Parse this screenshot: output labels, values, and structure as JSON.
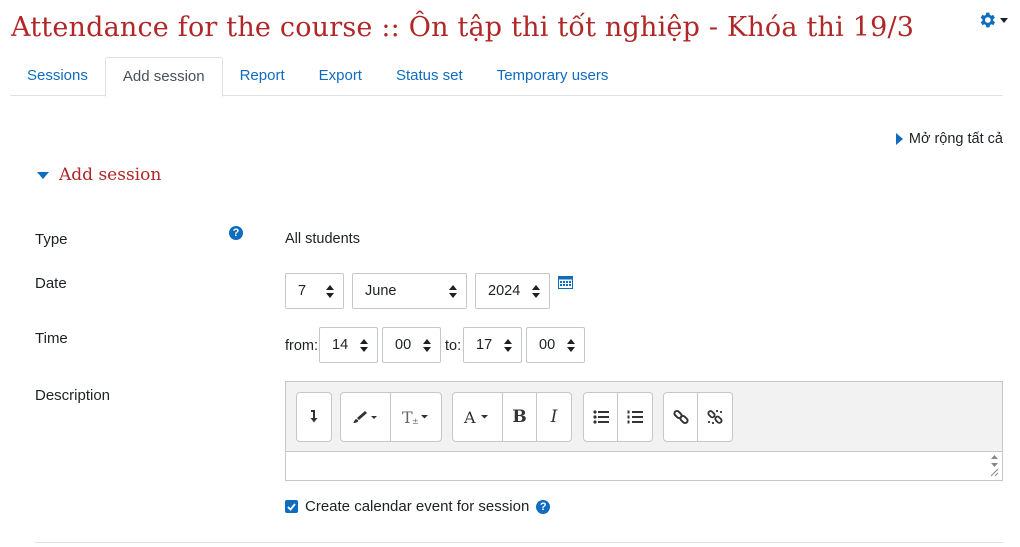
{
  "page": {
    "title": "Attendance for the course :: Ôn tập thi tốt nghiệp - Khóa thi 19/3"
  },
  "tabs": [
    "Sessions",
    "Add session",
    "Report",
    "Export",
    "Status set",
    "Temporary users"
  ],
  "active_tab": "Add session",
  "expand_all": "Mở rộng tất cả",
  "section": {
    "title": "Add session"
  },
  "form": {
    "type": {
      "label": "Type",
      "value": "All students"
    },
    "date": {
      "label": "Date",
      "day": "7",
      "month": "June",
      "year": "2024"
    },
    "time": {
      "label": "Time",
      "from_label": "from:",
      "from_hour": "14",
      "from_minute": "00",
      "to_label": "to:",
      "to_hour": "17",
      "to_minute": "00"
    },
    "description": {
      "label": "Description"
    },
    "calendar_event": {
      "label": "Create calendar event for session",
      "checked": true
    }
  },
  "icons": {
    "settings": "gear-icon",
    "help": "question-circle-icon",
    "calendar": "calendar-icon",
    "toolbar": [
      "collapse-toolbar-icon",
      "paintbrush-icon",
      "font-size-icon",
      "font-color-icon",
      "bold-icon",
      "italic-icon",
      "unordered-list-icon",
      "ordered-list-icon",
      "link-icon",
      "unlink-icon"
    ]
  },
  "colors": {
    "accent": "#0f6cbf",
    "title": "#b12626"
  }
}
